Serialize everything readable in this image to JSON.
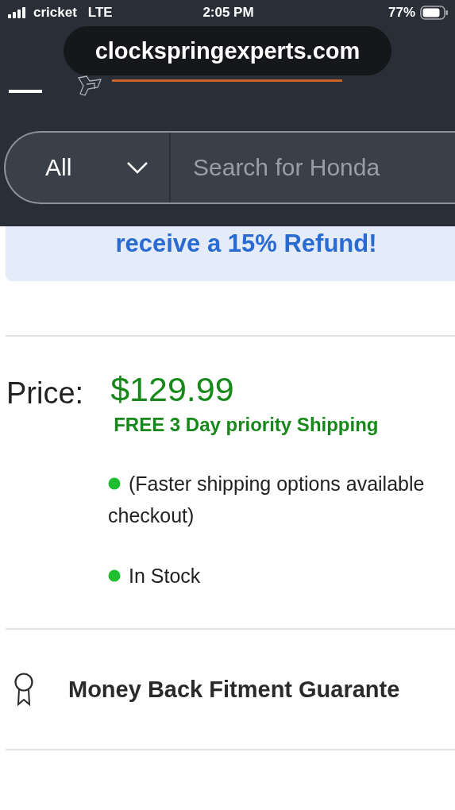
{
  "status_bar": {
    "carrier": "cricket",
    "network": "LTE",
    "time": "2:05 PM",
    "battery": "77%"
  },
  "address_bar": {
    "url": "clockspringexperts.com"
  },
  "search": {
    "category": "All",
    "placeholder": "Search for Honda"
  },
  "banner": {
    "text": "receive a 15% Refund!"
  },
  "price": {
    "label": "Price:",
    "amount": "$129.99",
    "shipping": "FREE 3 Day priority Shipping"
  },
  "notes": [
    {
      "lines": [
        "(Faster shipping options available",
        "checkout)"
      ]
    },
    {
      "lines": [
        "In Stock"
      ]
    }
  ],
  "guarantee": {
    "text": "Money Back Fitment Guarante"
  }
}
